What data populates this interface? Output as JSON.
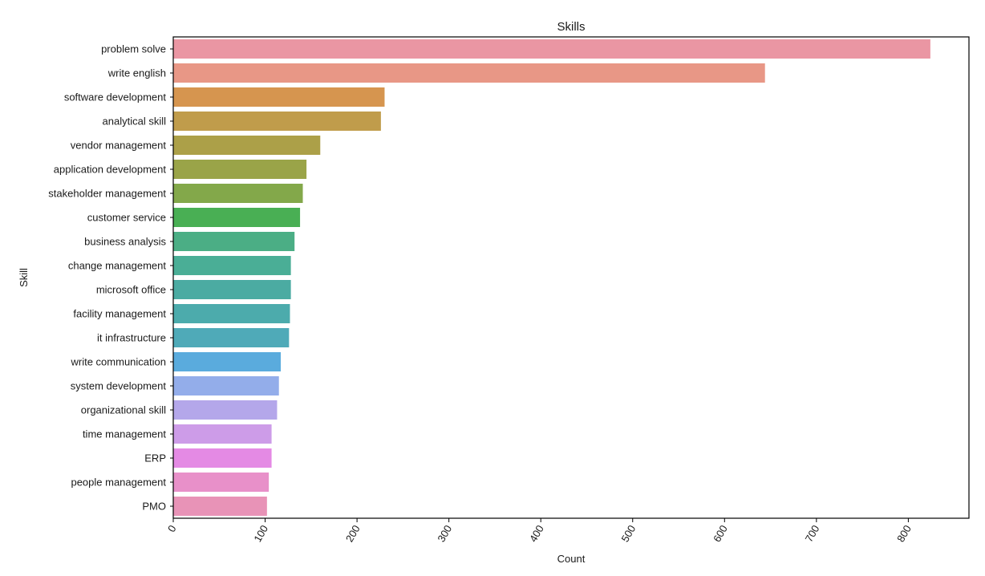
{
  "chart_data": {
    "type": "bar",
    "orientation": "horizontal",
    "title": "Skills",
    "xlabel": "Count",
    "ylabel": "Skill",
    "xlim": [
      0,
      866
    ],
    "xticks": [
      0,
      100,
      200,
      300,
      400,
      500,
      600,
      700,
      800
    ],
    "xtick_rotation_deg": 60,
    "grid": false,
    "legend": "none",
    "categories": [
      "problem solve",
      "write english",
      "software development",
      "analytical skill",
      "vendor management",
      "application development",
      "stakeholder management",
      "customer service",
      "business analysis",
      "change management",
      "microsoft office",
      "facility management",
      "it infrastructure",
      "write communication",
      "system development",
      "organizational skill",
      "time management",
      "ERP",
      "people management",
      "PMO"
    ],
    "values": [
      824,
      644,
      230,
      226,
      160,
      145,
      141,
      138,
      132,
      128,
      128,
      127,
      126,
      117,
      115,
      113,
      107,
      107,
      104,
      102
    ],
    "colors": [
      "#ea96a3",
      "#e89786",
      "#d6954f",
      "#c09c4b",
      "#aca048",
      "#9aa448",
      "#83a84a",
      "#49af54",
      "#4bae85",
      "#4aae96",
      "#4baba2",
      "#4cabac",
      "#4faab8",
      "#5aabdd",
      "#93adea",
      "#b4a7ea",
      "#cd9ce8",
      "#e48ae4",
      "#e890c9",
      "#e893b7"
    ]
  }
}
